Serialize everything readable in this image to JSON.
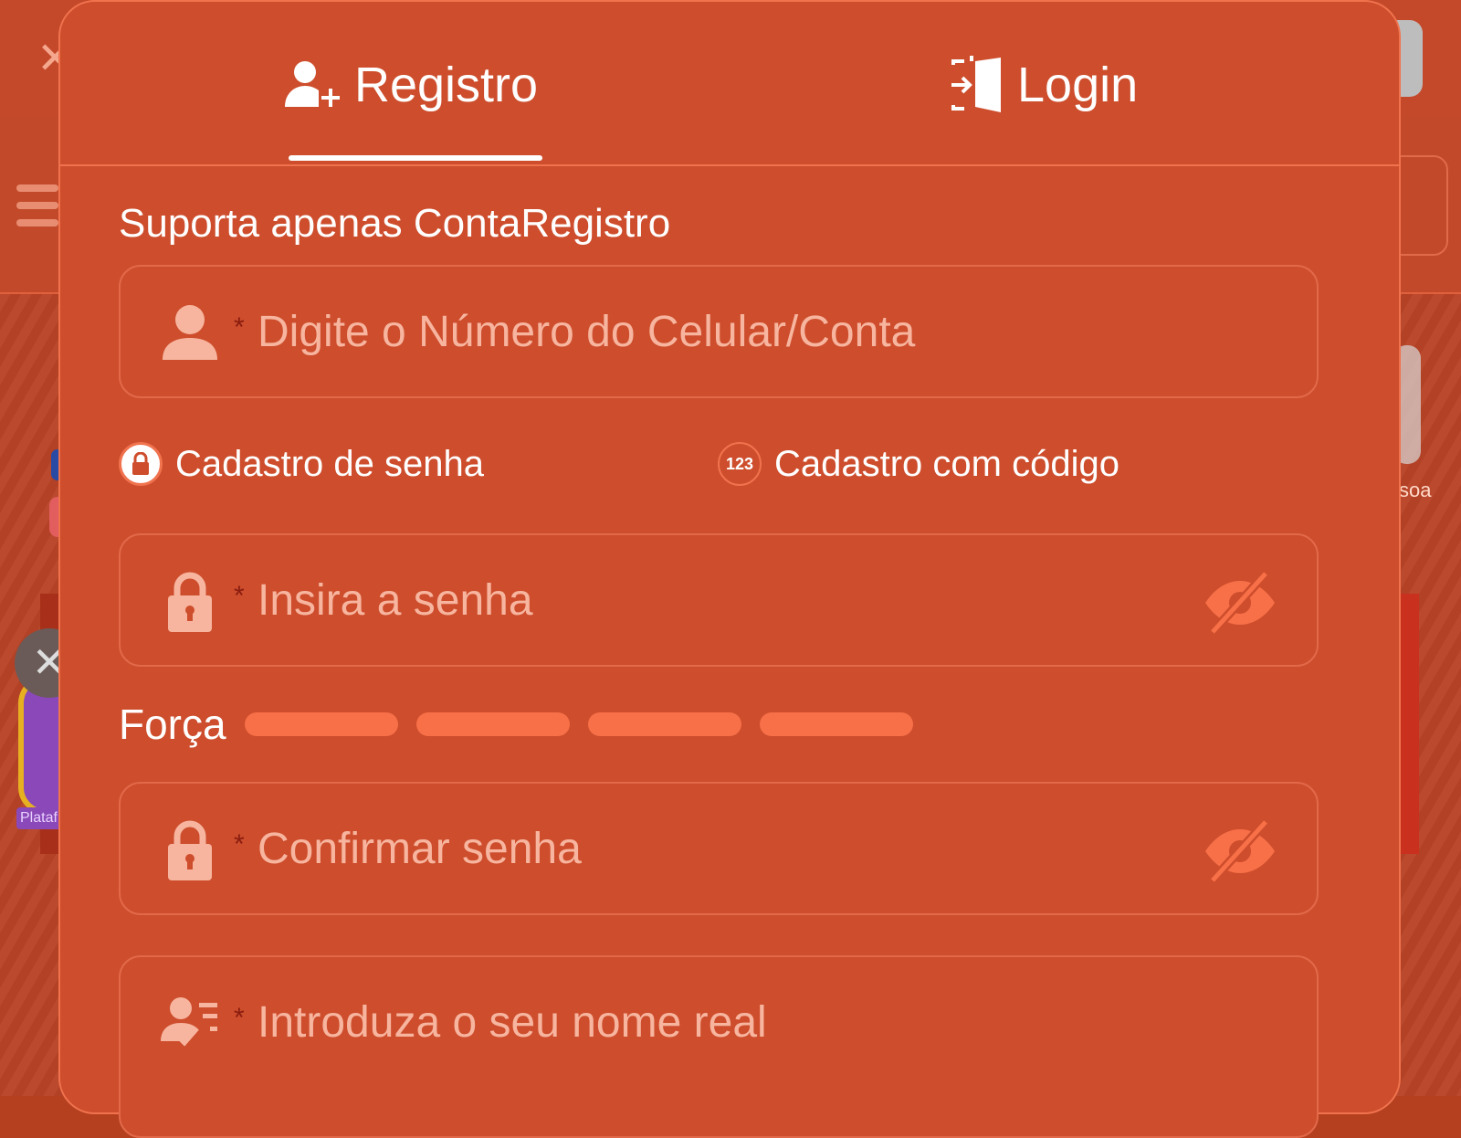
{
  "background": {
    "left_tag": "Plataf",
    "right_tag": "soa"
  },
  "tabs": [
    {
      "label": "Registro",
      "icon": "user-plus-icon",
      "active": true
    },
    {
      "label": "Login",
      "icon": "login-door-icon",
      "active": false
    }
  ],
  "form": {
    "section_title": "Suporta apenas ContaRegistro",
    "account": {
      "required_mark": "*",
      "placeholder": "Digite o Número do Celular/Conta",
      "icon": "user-icon"
    },
    "register_options": [
      {
        "label": "Cadastro de senha",
        "selected": true,
        "icon": "lock-icon"
      },
      {
        "label": "Cadastro com código",
        "selected": false,
        "icon_text": "123"
      }
    ],
    "password": {
      "required_mark": "*",
      "placeholder": "Insira a senha",
      "icon": "lock-icon",
      "toggle_icon": "eye-off-icon"
    },
    "strength": {
      "label": "Força",
      "bars": 4,
      "level": 0
    },
    "confirm_password": {
      "required_mark": "*",
      "placeholder": "Confirmar senha",
      "icon": "lock-icon",
      "toggle_icon": "eye-off-icon"
    },
    "real_name": {
      "required_mark": "*",
      "placeholder": "Introduza o seu nome real",
      "icon": "id-card-icon"
    }
  },
  "colors": {
    "modal_bg": "#cd4d2c",
    "accent": "#f87048",
    "placeholder": "#f7b59f"
  }
}
